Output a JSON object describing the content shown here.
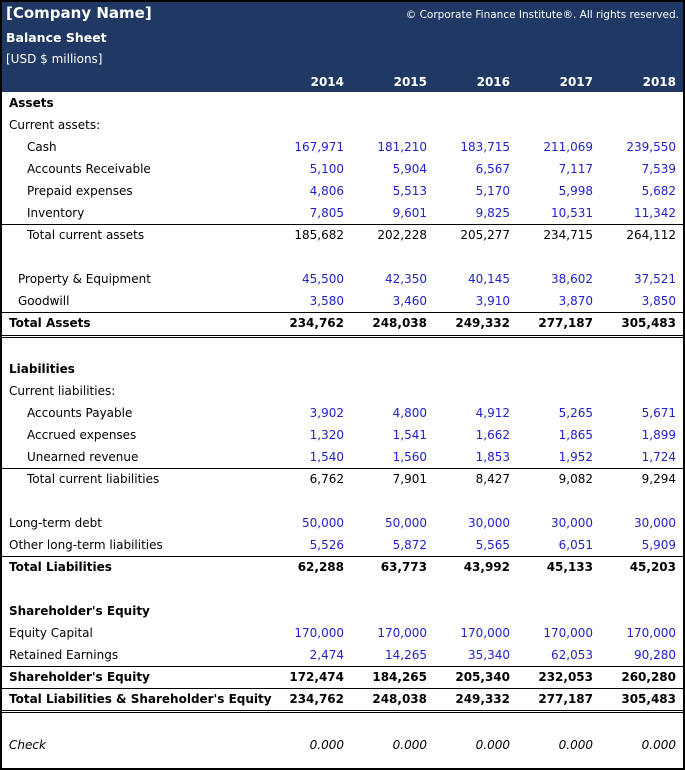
{
  "header": {
    "company": "[Company Name]",
    "copyright": "© Corporate Finance Institute®. All rights reserved.",
    "title": "Balance Sheet",
    "units": "[USD $ millions]",
    "years": [
      "2014",
      "2015",
      "2016",
      "2017",
      "2018"
    ],
    "background_color": "#1f3864"
  },
  "colors": {
    "input_blue": "#2222cc"
  },
  "rows": [
    {
      "label": "Assets",
      "values": [
        "",
        "",
        "",
        "",
        ""
      ]
    },
    {
      "label": "Current assets:",
      "values": [
        "",
        "",
        "",
        "",
        ""
      ]
    },
    {
      "label": "Cash",
      "values": [
        "167,971",
        "181,210",
        "183,715",
        "211,069",
        "239,550"
      ]
    },
    {
      "label": "Accounts Receivable",
      "values": [
        "5,100",
        "5,904",
        "6,567",
        "7,117",
        "7,539"
      ]
    },
    {
      "label": "Prepaid expenses",
      "values": [
        "4,806",
        "5,513",
        "5,170",
        "5,998",
        "5,682"
      ]
    },
    {
      "label": "Inventory",
      "values": [
        "7,805",
        "9,601",
        "9,825",
        "10,531",
        "11,342"
      ]
    },
    {
      "label": "Total current assets",
      "values": [
        "185,682",
        "202,228",
        "205,277",
        "234,715",
        "264,112"
      ]
    },
    {
      "label": "Property & Equipment",
      "values": [
        "45,500",
        "42,350",
        "40,145",
        "38,602",
        "37,521"
      ]
    },
    {
      "label": "Goodwill",
      "values": [
        "3,580",
        "3,460",
        "3,910",
        "3,870",
        "3,850"
      ]
    },
    {
      "label": "Total Assets",
      "values": [
        "234,762",
        "248,038",
        "249,332",
        "277,187",
        "305,483"
      ]
    },
    {
      "label": "Liabilities",
      "values": [
        "",
        "",
        "",
        "",
        ""
      ]
    },
    {
      "label": "Current liabilities:",
      "values": [
        "",
        "",
        "",
        "",
        ""
      ]
    },
    {
      "label": "Accounts Payable",
      "values": [
        "3,902",
        "4,800",
        "4,912",
        "5,265",
        "5,671"
      ]
    },
    {
      "label": "Accrued expenses",
      "values": [
        "1,320",
        "1,541",
        "1,662",
        "1,865",
        "1,899"
      ]
    },
    {
      "label": "Unearned revenue",
      "values": [
        "1,540",
        "1,560",
        "1,853",
        "1,952",
        "1,724"
      ]
    },
    {
      "label": "Total current liabilities",
      "values": [
        "6,762",
        "7,901",
        "8,427",
        "9,082",
        "9,294"
      ]
    },
    {
      "label": "Long-term debt",
      "values": [
        "50,000",
        "50,000",
        "30,000",
        "30,000",
        "30,000"
      ]
    },
    {
      "label": "Other long-term liabilities",
      "values": [
        "5,526",
        "5,872",
        "5,565",
        "6,051",
        "5,909"
      ]
    },
    {
      "label": "Total Liabilities",
      "values": [
        "62,288",
        "63,773",
        "43,992",
        "45,133",
        "45,203"
      ]
    },
    {
      "label": "Shareholder's Equity",
      "values": [
        "",
        "",
        "",
        "",
        ""
      ]
    },
    {
      "label": "Equity Capital",
      "values": [
        "170,000",
        "170,000",
        "170,000",
        "170,000",
        "170,000"
      ]
    },
    {
      "label": "Retained Earnings",
      "values": [
        "2,474",
        "14,265",
        "35,340",
        "62,053",
        "90,280"
      ]
    },
    {
      "label": "Shareholder's Equity",
      "values": [
        "172,474",
        "184,265",
        "205,340",
        "232,053",
        "260,280"
      ]
    },
    {
      "label": "Total Liabilities & Shareholder's Equity",
      "values": [
        "234,762",
        "248,038",
        "249,332",
        "277,187",
        "305,483"
      ]
    },
    {
      "label": "Check",
      "values": [
        "0.000",
        "0.000",
        "0.000",
        "0.000",
        "0.000"
      ]
    }
  ]
}
